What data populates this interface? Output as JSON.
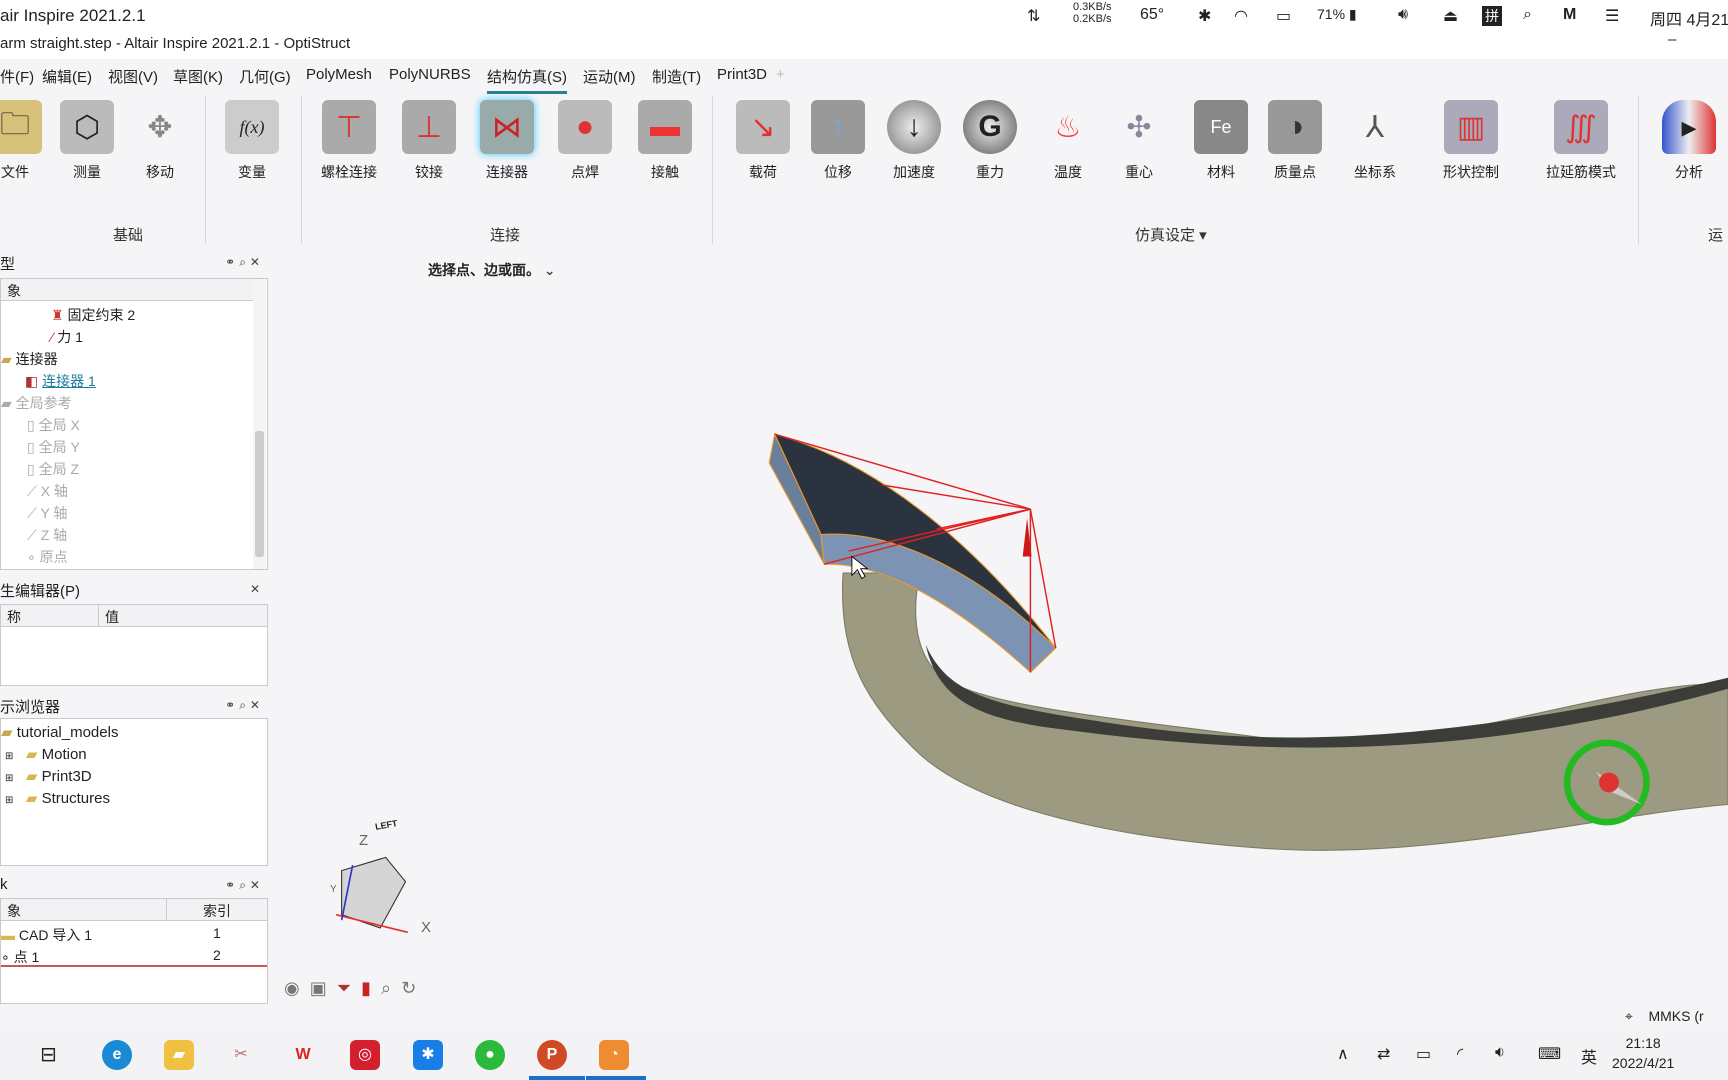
{
  "system_bar": {
    "app_name": "air Inspire 2021.2.1",
    "net_up": "0.3KB/s",
    "net_down": "0.2KB/s",
    "cpu_temp": "65°",
    "battery": "71%",
    "ime": "拼",
    "datetime": "周四 4月21"
  },
  "window": {
    "title": "arm straight.step - Altair Inspire 2021.2.1 - OptiStruct",
    "minimize": "–"
  },
  "menu": [
    "件(F)",
    "编辑(E)",
    "视图(V)",
    "草图(K)",
    "几何(G)",
    "PolyMesh",
    "PolyNURBS",
    "结构仿真(S)",
    "运动(M)",
    "制造(T)",
    "Print3D",
    "+"
  ],
  "menu_active_index": 7,
  "ribbon": {
    "buttons": [
      {
        "label": "文件",
        "icon": "folder-disk-icon"
      },
      {
        "label": "测量",
        "icon": "measure-icon"
      },
      {
        "label": "移动",
        "icon": "move-icon"
      },
      {
        "label": "变量",
        "icon": "variable-fx-icon"
      },
      {
        "label": "螺栓连接",
        "icon": "bolt-icon"
      },
      {
        "label": "铰接",
        "icon": "pin-joint-icon"
      },
      {
        "label": "连接器",
        "icon": "connector-icon"
      },
      {
        "label": "点焊",
        "icon": "spot-weld-icon"
      },
      {
        "label": "接触",
        "icon": "contact-icon"
      },
      {
        "label": "载荷",
        "icon": "load-icon"
      },
      {
        "label": "位移",
        "icon": "displacement-icon"
      },
      {
        "label": "加速度",
        "icon": "acceleration-icon"
      },
      {
        "label": "重力",
        "icon": "gravity-icon"
      },
      {
        "label": "温度",
        "icon": "temperature-icon"
      },
      {
        "label": "重心",
        "icon": "center-of-mass-icon"
      },
      {
        "label": "材料",
        "icon": "material-icon"
      },
      {
        "label": "质量点",
        "icon": "point-mass-icon"
      },
      {
        "label": "坐标系",
        "icon": "coordinate-system-icon"
      },
      {
        "label": "形状控制",
        "icon": "shape-control-icon"
      },
      {
        "label": "拉延筋模式",
        "icon": "draw-bead-icon"
      },
      {
        "label": "分析",
        "icon": "analyze-icon"
      }
    ],
    "groups": [
      "基础",
      "连接",
      "仿真设定 ▾",
      "运"
    ]
  },
  "model_tree": {
    "header": "型",
    "column": "象",
    "items": [
      {
        "label": "固定约束 2",
        "state": "normal"
      },
      {
        "label": "力 1",
        "state": "normal"
      },
      {
        "label": "连接器",
        "state": "folder"
      },
      {
        "label": "连接器 1",
        "state": "link"
      },
      {
        "label": "全局参考",
        "state": "dim"
      },
      {
        "label": "全局 X",
        "state": "dim"
      },
      {
        "label": "全局 Y",
        "state": "dim"
      },
      {
        "label": "全局 Z",
        "state": "dim"
      },
      {
        "label": "X 轴",
        "state": "dim"
      },
      {
        "label": "Y 轴",
        "state": "dim"
      },
      {
        "label": "Z 轴",
        "state": "dim"
      },
      {
        "label": "原点",
        "state": "dim"
      }
    ]
  },
  "property_editor": {
    "header": "生编辑器(P)",
    "columns": [
      "称",
      "值"
    ]
  },
  "browser": {
    "header": "示浏览器",
    "items": [
      "tutorial_models",
      "Motion",
      "Print3D",
      "Structures"
    ]
  },
  "list_panel": {
    "header": "k",
    "columns": [
      "象",
      "索引"
    ],
    "rows": [
      {
        "name": "CAD 导入 1",
        "index": "1"
      },
      {
        "name": "点 1",
        "index": "2"
      }
    ]
  },
  "viewport": {
    "prompt": "选择点、边或面。",
    "cube_face": "LEFT",
    "axis_z": "Z",
    "axis_x": "X",
    "axis_y": "Y",
    "units": "MMKS (r"
  },
  "taskbar": {
    "time": "21:18",
    "date": "2022/4/21",
    "ime": "英"
  }
}
